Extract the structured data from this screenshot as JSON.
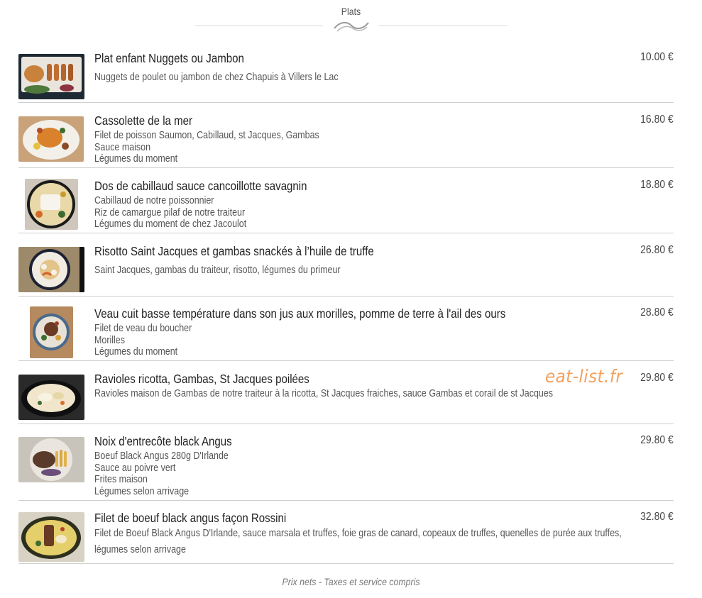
{
  "section": {
    "title": "Plats"
  },
  "watermark": "eat-list.fr",
  "footer": "Prix nets - Taxes et service compris",
  "items": [
    {
      "name": "Plat enfant Nuggets ou Jambon",
      "lines": [
        "Nuggets de poulet ou jambon de chez Chapuis à Villers le Lac"
      ],
      "price": "10.00 €",
      "image": "nuggets-photo"
    },
    {
      "name": "Cassolette de la mer",
      "lines": [
        "Filet de poisson Saumon, Cabillaud, st Jacques, Gambas",
        "Sauce maison",
        "Légumes du moment"
      ],
      "price": "16.80 €",
      "image": "cassolette-photo"
    },
    {
      "name": "Dos de cabillaud sauce cancoillotte savagnin",
      "lines": [
        "Cabillaud de notre poissonnier",
        "Riz de camargue pilaf de notre traiteur",
        "Légumes du moment de chez Jacoulot"
      ],
      "price": "18.80 €",
      "image": "cabillaud-photo"
    },
    {
      "name": "Risotto Saint Jacques et gambas snackés à l’huile de truffe",
      "lines": [
        "Saint Jacques, gambas du traiteur, risotto, légumes du primeur"
      ],
      "price": "26.80 €",
      "image": "risotto-photo"
    },
    {
      "name": "Veau cuit basse température dans son jus aux morilles, pomme de terre à l'ail des ours",
      "lines": [
        "Filet de veau du boucher",
        "Morilles",
        "Légumes du moment"
      ],
      "price": "28.80 €",
      "image": "veau-photo"
    },
    {
      "name": "Ravioles ricotta, Gambas, St Jacques poilées",
      "lines": [
        "Ravioles maison de Gambas de notre traiteur à la ricotta, St Jacques fraiches, sauce Gambas et corail de st Jacques"
      ],
      "price": "29.80 €",
      "image": "ravioles-photo"
    },
    {
      "name": "Noix d'entrecôte black Angus",
      "lines": [
        "Boeuf Black Angus 280g  D'Irlande",
        "Sauce au poivre vert",
        "Frites maison",
        "Légumes selon arrivage"
      ],
      "price": "29.80 €",
      "image": "entrecote-photo"
    },
    {
      "name": "Filet de boeuf black angus façon Rossini",
      "lines": [
        "Filet de Boeuf  Black Angus D'Irlande, sauce marsala et truffes, foie gras de canard, copeaux de truffes, quenelles de purée aux truffes, légumes selon arrivage"
      ],
      "price": "32.80 €",
      "image": "rossini-photo"
    }
  ]
}
